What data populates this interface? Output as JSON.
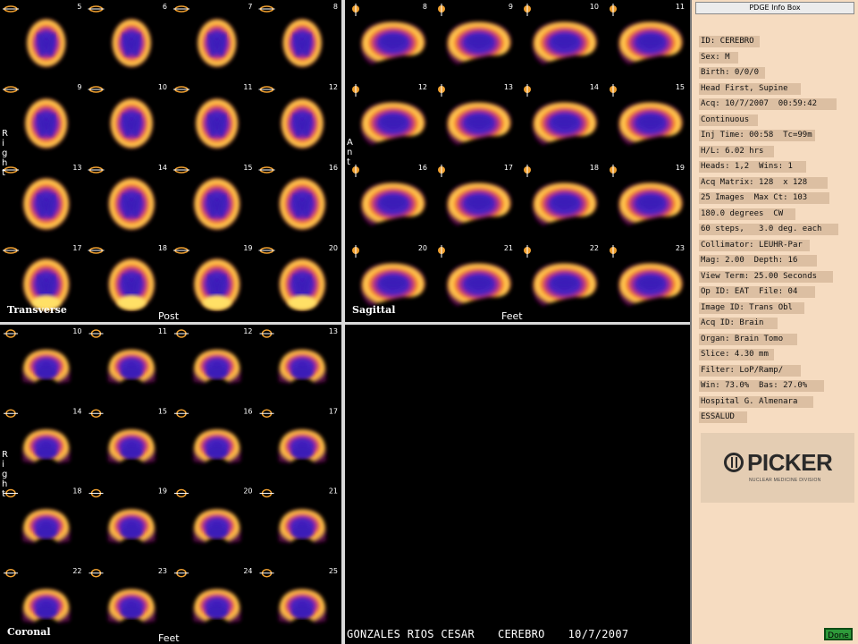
{
  "transverse": {
    "label": "Transverse",
    "bottom_dir": "Post",
    "side_label": "Right",
    "slices": [
      5,
      6,
      7,
      8,
      9,
      10,
      11,
      12,
      13,
      14,
      15,
      16,
      17,
      18,
      19,
      20
    ]
  },
  "sagittal": {
    "label": "Sagittal",
    "bottom_dir": "Feet",
    "side_label": "Ant",
    "slices": [
      8,
      9,
      10,
      11,
      12,
      13,
      14,
      15,
      16,
      17,
      18,
      19,
      20,
      21,
      22,
      23
    ]
  },
  "coronal": {
    "label": "Coronal",
    "bottom_dir": "Feet",
    "side_label": "Right",
    "slices": [
      10,
      11,
      12,
      13,
      14,
      15,
      16,
      17,
      18,
      19,
      20,
      21,
      22,
      23,
      24,
      25
    ]
  },
  "patient_bar": {
    "name": "GONZALES RIOS CESAR",
    "study": "CEREBRO",
    "date": "10/7/2007"
  },
  "info_box": {
    "title": "PDGE Info Box",
    "lines": [
      "ID: CEREBRO",
      "Sex: M",
      "Birth: 0/0/0",
      "Head First, Supine",
      "Acq: 10/7/2007  00:59:42",
      "Continuous",
      "Inj Time: 00:58  Tc=99m",
      "H/L: 6.02 hrs",
      "Heads: 1,2  Wins: 1",
      "Acq Matrix: 128  x 128",
      "25 Images  Max Ct: 103",
      "180.0 degrees  CW",
      "60 steps,   3.0 deg. each",
      "Collimator: LEUHR-Par",
      "Mag: 2.00  Depth: 16",
      "View Term: 25.00 Seconds",
      "Op ID: EAT  File: 04",
      "Image ID: Trans Obl",
      "Acq ID: Brain",
      "Organ: Brain Tomo",
      "Slice: 4.30 mm",
      "Filter: LoP/Ramp/",
      "Win: 73.0%  Bas: 27.0%",
      "Hospital G. Almenara",
      "ESSALUD"
    ],
    "logo_text": "PICKER",
    "logo_sub": "NUCLEAR MEDICINE DIVISION",
    "done_label": "Done"
  },
  "colors": {
    "background": "#000000",
    "hot_core": "#ffe066",
    "hot_mid": "#ff8c1a",
    "hot_edge": "#9b1a6a",
    "low_activity": "#3a1fb8",
    "info_bg": "#f6dcc1",
    "done_green": "#2e9a3a"
  }
}
